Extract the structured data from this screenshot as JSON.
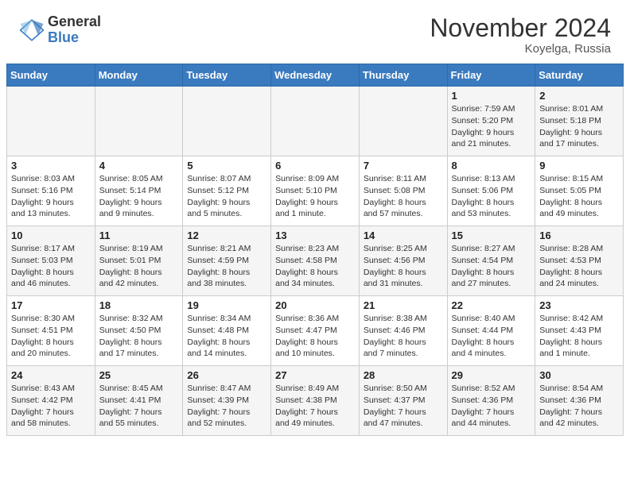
{
  "logo": {
    "general": "General",
    "blue": "Blue"
  },
  "title": "November 2024",
  "location": "Koyelga, Russia",
  "weekdays": [
    "Sunday",
    "Monday",
    "Tuesday",
    "Wednesday",
    "Thursday",
    "Friday",
    "Saturday"
  ],
  "weeks": [
    [
      {
        "day": "",
        "info": ""
      },
      {
        "day": "",
        "info": ""
      },
      {
        "day": "",
        "info": ""
      },
      {
        "day": "",
        "info": ""
      },
      {
        "day": "",
        "info": ""
      },
      {
        "day": "1",
        "info": "Sunrise: 7:59 AM\nSunset: 5:20 PM\nDaylight: 9 hours\nand 21 minutes."
      },
      {
        "day": "2",
        "info": "Sunrise: 8:01 AM\nSunset: 5:18 PM\nDaylight: 9 hours\nand 17 minutes."
      }
    ],
    [
      {
        "day": "3",
        "info": "Sunrise: 8:03 AM\nSunset: 5:16 PM\nDaylight: 9 hours\nand 13 minutes."
      },
      {
        "day": "4",
        "info": "Sunrise: 8:05 AM\nSunset: 5:14 PM\nDaylight: 9 hours\nand 9 minutes."
      },
      {
        "day": "5",
        "info": "Sunrise: 8:07 AM\nSunset: 5:12 PM\nDaylight: 9 hours\nand 5 minutes."
      },
      {
        "day": "6",
        "info": "Sunrise: 8:09 AM\nSunset: 5:10 PM\nDaylight: 9 hours\nand 1 minute."
      },
      {
        "day": "7",
        "info": "Sunrise: 8:11 AM\nSunset: 5:08 PM\nDaylight: 8 hours\nand 57 minutes."
      },
      {
        "day": "8",
        "info": "Sunrise: 8:13 AM\nSunset: 5:06 PM\nDaylight: 8 hours\nand 53 minutes."
      },
      {
        "day": "9",
        "info": "Sunrise: 8:15 AM\nSunset: 5:05 PM\nDaylight: 8 hours\nand 49 minutes."
      }
    ],
    [
      {
        "day": "10",
        "info": "Sunrise: 8:17 AM\nSunset: 5:03 PM\nDaylight: 8 hours\nand 46 minutes."
      },
      {
        "day": "11",
        "info": "Sunrise: 8:19 AM\nSunset: 5:01 PM\nDaylight: 8 hours\nand 42 minutes."
      },
      {
        "day": "12",
        "info": "Sunrise: 8:21 AM\nSunset: 4:59 PM\nDaylight: 8 hours\nand 38 minutes."
      },
      {
        "day": "13",
        "info": "Sunrise: 8:23 AM\nSunset: 4:58 PM\nDaylight: 8 hours\nand 34 minutes."
      },
      {
        "day": "14",
        "info": "Sunrise: 8:25 AM\nSunset: 4:56 PM\nDaylight: 8 hours\nand 31 minutes."
      },
      {
        "day": "15",
        "info": "Sunrise: 8:27 AM\nSunset: 4:54 PM\nDaylight: 8 hours\nand 27 minutes."
      },
      {
        "day": "16",
        "info": "Sunrise: 8:28 AM\nSunset: 4:53 PM\nDaylight: 8 hours\nand 24 minutes."
      }
    ],
    [
      {
        "day": "17",
        "info": "Sunrise: 8:30 AM\nSunset: 4:51 PM\nDaylight: 8 hours\nand 20 minutes."
      },
      {
        "day": "18",
        "info": "Sunrise: 8:32 AM\nSunset: 4:50 PM\nDaylight: 8 hours\nand 17 minutes."
      },
      {
        "day": "19",
        "info": "Sunrise: 8:34 AM\nSunset: 4:48 PM\nDaylight: 8 hours\nand 14 minutes."
      },
      {
        "day": "20",
        "info": "Sunrise: 8:36 AM\nSunset: 4:47 PM\nDaylight: 8 hours\nand 10 minutes."
      },
      {
        "day": "21",
        "info": "Sunrise: 8:38 AM\nSunset: 4:46 PM\nDaylight: 8 hours\nand 7 minutes."
      },
      {
        "day": "22",
        "info": "Sunrise: 8:40 AM\nSunset: 4:44 PM\nDaylight: 8 hours\nand 4 minutes."
      },
      {
        "day": "23",
        "info": "Sunrise: 8:42 AM\nSunset: 4:43 PM\nDaylight: 8 hours\nand 1 minute."
      }
    ],
    [
      {
        "day": "24",
        "info": "Sunrise: 8:43 AM\nSunset: 4:42 PM\nDaylight: 7 hours\nand 58 minutes."
      },
      {
        "day": "25",
        "info": "Sunrise: 8:45 AM\nSunset: 4:41 PM\nDaylight: 7 hours\nand 55 minutes."
      },
      {
        "day": "26",
        "info": "Sunrise: 8:47 AM\nSunset: 4:39 PM\nDaylight: 7 hours\nand 52 minutes."
      },
      {
        "day": "27",
        "info": "Sunrise: 8:49 AM\nSunset: 4:38 PM\nDaylight: 7 hours\nand 49 minutes."
      },
      {
        "day": "28",
        "info": "Sunrise: 8:50 AM\nSunset: 4:37 PM\nDaylight: 7 hours\nand 47 minutes."
      },
      {
        "day": "29",
        "info": "Sunrise: 8:52 AM\nSunset: 4:36 PM\nDaylight: 7 hours\nand 44 minutes."
      },
      {
        "day": "30",
        "info": "Sunrise: 8:54 AM\nSunset: 4:36 PM\nDaylight: 7 hours\nand 42 minutes."
      }
    ]
  ]
}
